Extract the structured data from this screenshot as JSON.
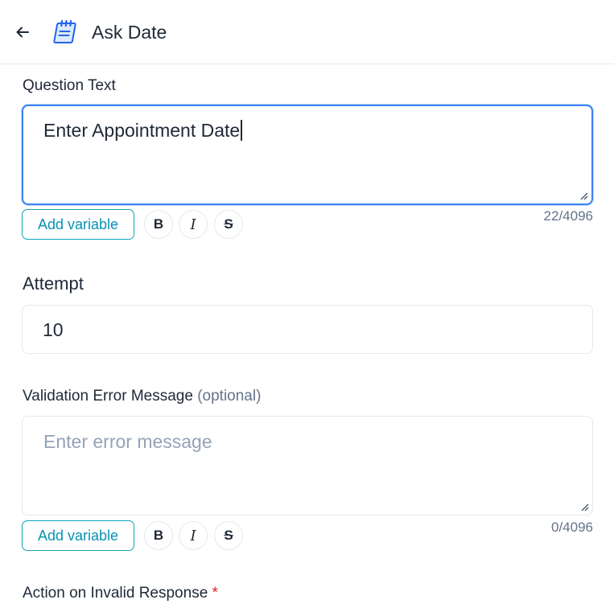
{
  "header": {
    "back_icon": "arrow-left-icon",
    "node_icon": "notepad-icon",
    "title": "Ask Date"
  },
  "question_text": {
    "label": "Question Text",
    "value": "Enter Appointment Date",
    "counter": "22/4096",
    "add_variable_label": "Add variable",
    "bold_label": "B",
    "italic_label": "I",
    "strike_label": "S"
  },
  "attempt": {
    "label": "Attempt",
    "value": "10"
  },
  "validation_error": {
    "label": "Validation Error Message",
    "optional_label": "(optional)",
    "placeholder": "Enter error message",
    "counter": "0/4096",
    "add_variable_label": "Add variable",
    "bold_label": "B",
    "italic_label": "I",
    "strike_label": "S"
  },
  "invalid_action": {
    "label": "Action on Invalid Response",
    "required_mark": "*"
  },
  "colors": {
    "accent": "#0891b2",
    "focus_border": "#3b82f6",
    "required": "#dc2626",
    "muted_text": "#64748b",
    "placeholder": "#94a3b8"
  }
}
